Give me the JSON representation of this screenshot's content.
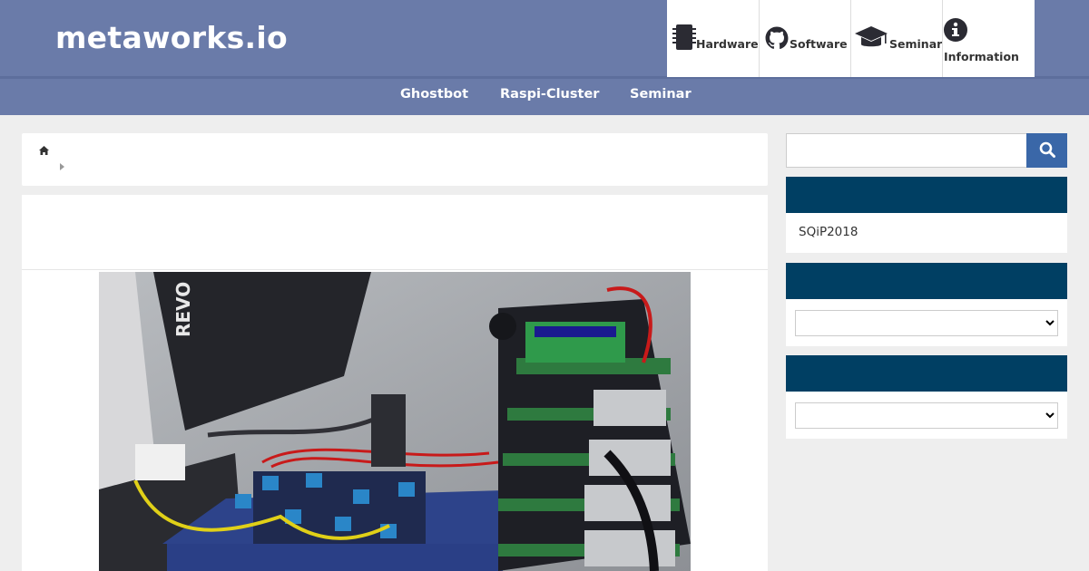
{
  "site": {
    "logo_text": "metaworks.io"
  },
  "topnav": [
    {
      "label": "Hardware",
      "icon": "chip-icon"
    },
    {
      "label": "Software",
      "icon": "github-icon"
    },
    {
      "label": "Seminar",
      "icon": "graduation-cap-icon"
    },
    {
      "label": "Information",
      "icon": "info-circle-icon"
    }
  ],
  "subnav": [
    {
      "label": "Ghostbot"
    },
    {
      "label": "Raspi-Cluster"
    },
    {
      "label": "Seminar"
    }
  ],
  "breadcrumb": {
    "home_icon": "home-icon",
    "separator_icon": "caret-right-icon"
  },
  "article": {
    "image": "photo of Raspberry Pi cluster with relay boards, cables and power supply"
  },
  "sidebar": {
    "search": {
      "placeholder": "",
      "button_icon": "search-icon"
    },
    "widgets": [
      {
        "links": [
          "SQiP2018"
        ]
      },
      {
        "select_value": ""
      },
      {
        "select_value": ""
      }
    ]
  },
  "colors": {
    "header_bg": "#6a7ba9",
    "widget_head": "#003f63",
    "search_button": "#3a67a8",
    "page_bg": "#eeeeee"
  }
}
